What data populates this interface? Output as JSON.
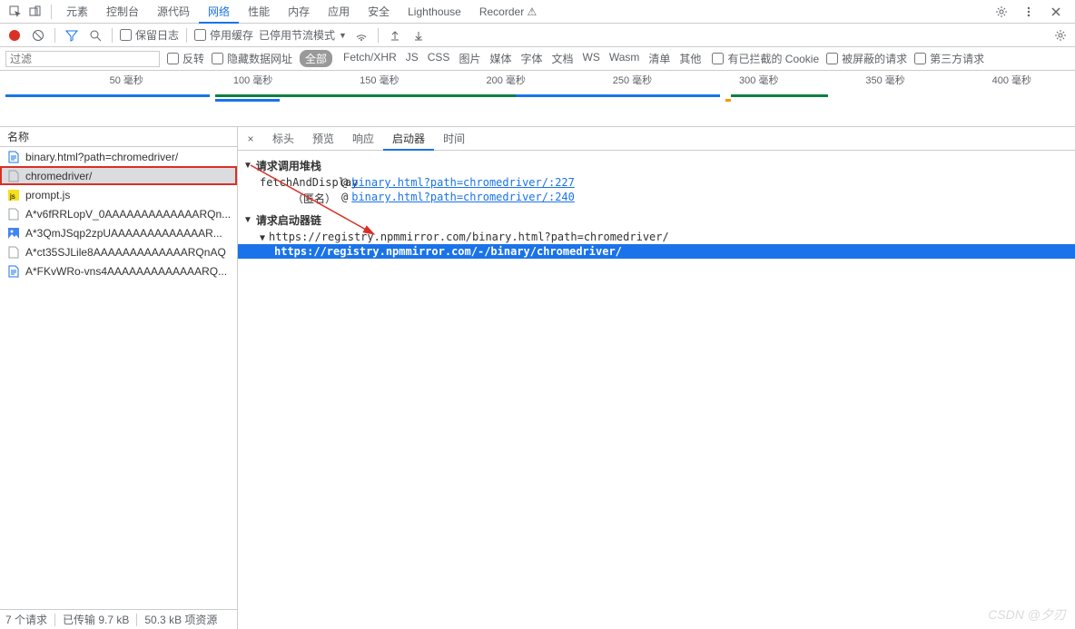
{
  "topTabs": {
    "items": [
      "元素",
      "控制台",
      "源代码",
      "网络",
      "性能",
      "内存",
      "应用",
      "安全",
      "Lighthouse",
      "Recorder ⚠"
    ],
    "activeIndex": 3
  },
  "netToolbar": {
    "preserveLog": "保留日志",
    "disableCache": "停用缓存",
    "throttling": "已停用节流模式"
  },
  "filterRow": {
    "filterPlaceholder": "过滤",
    "invert": "反转",
    "hideDataUrls": "隐藏数据网址",
    "all": "全部",
    "types": [
      "Fetch/XHR",
      "JS",
      "CSS",
      "图片",
      "媒体",
      "字体",
      "文档",
      "WS",
      "Wasm",
      "清单",
      "其他"
    ],
    "blockedCookies": "有已拦截的 Cookie",
    "blockedRequests": "被屏蔽的请求",
    "thirdParty": "第三方请求"
  },
  "timeline": {
    "ticks": [
      "50 毫秒",
      "100 毫秒",
      "150 毫秒",
      "200 毫秒",
      "250 毫秒",
      "300 毫秒",
      "350 毫秒",
      "400 毫秒"
    ]
  },
  "leftPanel": {
    "header": "名称",
    "requests": [
      {
        "icon": "doc-blue",
        "name": "binary.html?path=chromedriver/",
        "selected": false,
        "highlighted": false
      },
      {
        "icon": "doc-grey",
        "name": "chromedriver/",
        "selected": true,
        "highlighted": true
      },
      {
        "icon": "js",
        "name": "prompt.js",
        "selected": false,
        "highlighted": false
      },
      {
        "icon": "doc-grey",
        "name": "A*v6fRRLopV_0AAAAAAAAAAAAARQn...",
        "selected": false,
        "highlighted": false
      },
      {
        "icon": "img",
        "name": "A*3QmJSqp2zpUAAAAAAAAAAAAAR...",
        "selected": false,
        "highlighted": false
      },
      {
        "icon": "doc-grey",
        "name": "A*ct35SJLile8AAAAAAAAAAAAARQnAQ",
        "selected": false,
        "highlighted": false
      },
      {
        "icon": "doc-blue",
        "name": "A*FKvWRo-vns4AAAAAAAAAAAAARQ...",
        "selected": false,
        "highlighted": false
      }
    ]
  },
  "statusBar": {
    "requests": "7 个请求",
    "transferred": "已传输 9.7 kB",
    "resources": "50.3 kB 项资源"
  },
  "detailTabs": {
    "items": [
      "标头",
      "预览",
      "响应",
      "启动器",
      "时间"
    ],
    "activeIndex": 3
  },
  "initiator": {
    "callStackTitle": "请求调用堆栈",
    "stack": [
      {
        "fn": "fetchAndDisplay",
        "at": "@",
        "link": "binary.html?path=chromedriver/:227"
      },
      {
        "fn": "（匿名）",
        "at": "@",
        "link": "binary.html?path=chromedriver/:240"
      }
    ],
    "chainTitle": "请求启动器链",
    "chain": [
      {
        "text": "https://registry.npmmirror.com/binary.html?path=chromedriver/",
        "nested": false,
        "selected": false,
        "hasTri": true
      },
      {
        "text": "https://registry.npmmirror.com/-/binary/chromedriver/",
        "nested": true,
        "selected": true,
        "hasTri": false
      }
    ]
  },
  "watermark": "CSDN @夕刃"
}
